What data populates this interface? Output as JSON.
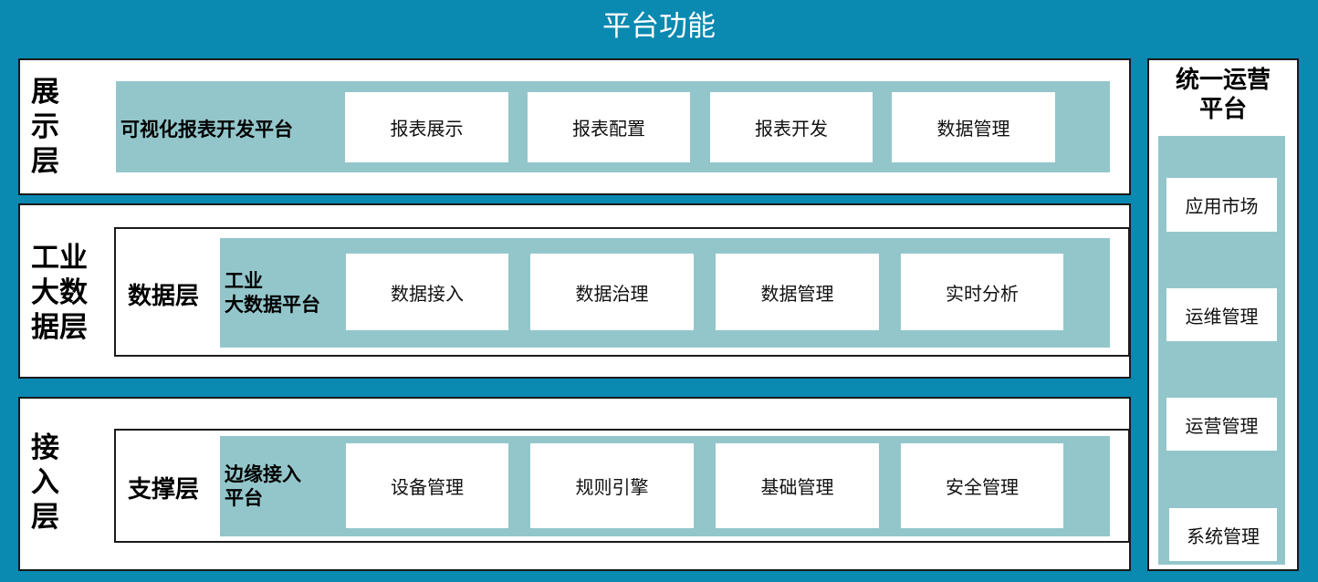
{
  "title": "平台功能",
  "layers": {
    "presentation": {
      "label_lines": [
        "展",
        "示",
        "层"
      ],
      "platform": "可视化报表开发平台",
      "modules": [
        "报表展示",
        "报表配置",
        "报表开发",
        "数据管理"
      ]
    },
    "bigdata": {
      "label_lines": [
        "工业",
        "大数",
        "据层"
      ],
      "sublayer": "数据层",
      "platform_lines": [
        "工业",
        "大数据平台"
      ],
      "modules": [
        "数据接入",
        "数据治理",
        "数据管理",
        "实时分析"
      ]
    },
    "access": {
      "label_lines": [
        "接",
        "入",
        "层"
      ],
      "sublayer": "支撑层",
      "platform_lines": [
        "边缘接入",
        "平台"
      ],
      "modules": [
        "设备管理",
        "规则引擎",
        "基础管理",
        "安全管理"
      ]
    }
  },
  "ops": {
    "title_lines": [
      "统一运营",
      "平台"
    ],
    "items": [
      "应用市场",
      "运维管理",
      "运营管理",
      "系统管理"
    ]
  },
  "colors": {
    "background": "#0a89b1",
    "teal": "#93c6cb",
    "box": "#ffffff"
  }
}
